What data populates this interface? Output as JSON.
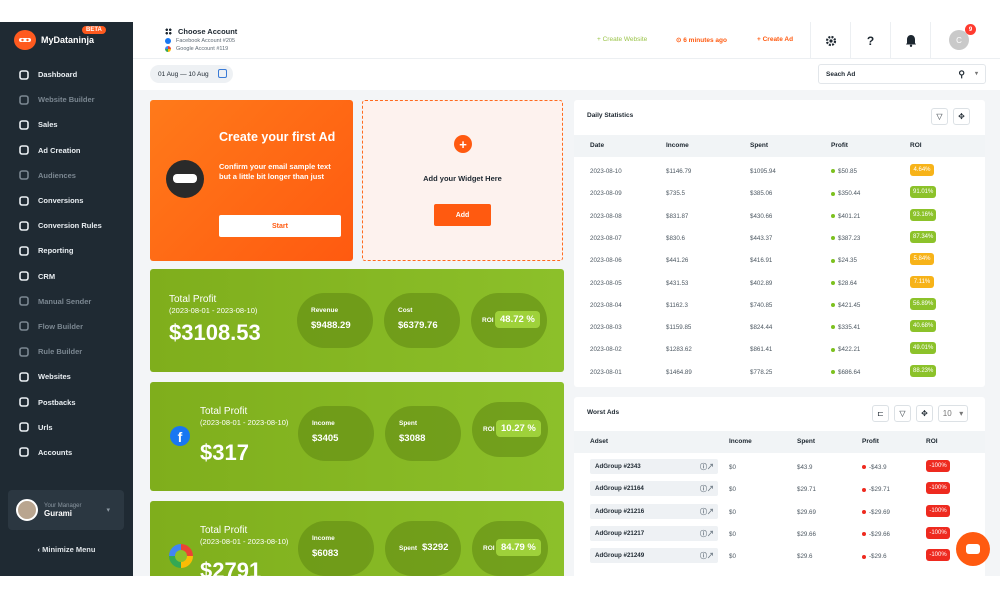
{
  "brand": {
    "name": "MyDataninja",
    "badge": "BETA"
  },
  "nav": [
    {
      "label": "Dashboard",
      "icon": "dashboard-icon",
      "dim": false
    },
    {
      "label": "Website Builder",
      "icon": "website-builder-icon",
      "dim": true
    },
    {
      "label": "Sales",
      "icon": "sales-icon",
      "dim": false
    },
    {
      "label": "Ad Creation",
      "icon": "megaphone-icon",
      "dim": false
    },
    {
      "label": "Audiences",
      "icon": "audiences-icon",
      "dim": true
    },
    {
      "label": "Conversions",
      "icon": "conversions-icon",
      "dim": false
    },
    {
      "label": "Conversion Rules",
      "icon": "conversion-rules-icon",
      "dim": false
    },
    {
      "label": "Reporting",
      "icon": "reporting-icon",
      "dim": false
    },
    {
      "label": "CRM",
      "icon": "crm-icon",
      "dim": false
    },
    {
      "label": "Manual Sender",
      "icon": "send-icon",
      "dim": true
    },
    {
      "label": "Flow Builder",
      "icon": "flow-icon",
      "dim": true
    },
    {
      "label": "Rule Builder",
      "icon": "rule-icon",
      "dim": true
    },
    {
      "label": "Websites",
      "icon": "globe-icon",
      "dim": false
    },
    {
      "label": "Postbacks",
      "icon": "anchor-icon",
      "dim": false
    },
    {
      "label": "Urls",
      "icon": "link-icon",
      "dim": false
    },
    {
      "label": "Accounts",
      "icon": "accounts-icon",
      "dim": false
    }
  ],
  "manager": {
    "label": "Your Manager",
    "name": "Gurami"
  },
  "minimize_label": "‹ Minimize Menu",
  "topbar": {
    "account_title": "Choose Account",
    "account_fb": "Facebook Account #205",
    "account_google": "Google Account #119",
    "create_website": "+ Create Website",
    "time_ago": "6 minutes ago",
    "create_ad": "+ Create Ad",
    "avatar_letter": "C",
    "notif_count": "9"
  },
  "date_range": {
    "from": "01 Aug",
    "to": "— 10 Aug"
  },
  "search": {
    "value": "Seach Ad"
  },
  "create_card": {
    "title": "Create your first Ad",
    "text": "Confirm your email sample text but a little bit longer than just",
    "button": "Start"
  },
  "widget_card": {
    "text": "Add your Widget Here",
    "button": "Add"
  },
  "profit_total": {
    "title": "Total Profit",
    "date": "(2023-08-01 - 2023-08-10)",
    "amount": "$3108.53",
    "revenue_label": "Revenue",
    "revenue": "$9488.29",
    "cost_label": "Cost",
    "cost": "$6379.76",
    "roi_label": "ROI",
    "roi": "48.72 %"
  },
  "profit_facebook": {
    "title": "Total Profit",
    "date": "(2023-08-01 - 2023-08-10)",
    "amount": "$317",
    "income_label": "Income",
    "income": "$3405",
    "spent_label": "Spent",
    "spent": "$3088",
    "roi_label": "ROI",
    "roi": "10.27 %"
  },
  "profit_google": {
    "title": "Total Profit",
    "date": "(2023-08-01 - 2023-08-10)",
    "amount": "$2791",
    "income_label": "Income",
    "income": "$6083",
    "spent_label": "Spent",
    "spent": "$3292",
    "roi_label": "ROI",
    "roi": "84.79 %"
  },
  "daily": {
    "title": "Daily Statistics",
    "headers": [
      "Date",
      "Income",
      "Spent",
      "Profit",
      "ROI"
    ],
    "rows": [
      {
        "date": "2023-08-10",
        "income": "$1146.79",
        "spent": "$1095.94",
        "profit": "$50.85",
        "roi": "4.64%",
        "color": "#f7b319"
      },
      {
        "date": "2023-08-09",
        "income": "$735.5",
        "spent": "$385.06",
        "profit": "$350.44",
        "roi": "91.01%",
        "color": "#8cc22a"
      },
      {
        "date": "2023-08-08",
        "income": "$831.87",
        "spent": "$430.66",
        "profit": "$401.21",
        "roi": "93.16%",
        "color": "#8cc22a"
      },
      {
        "date": "2023-08-07",
        "income": "$830.6",
        "spent": "$443.37",
        "profit": "$387.23",
        "roi": "87.34%",
        "color": "#8cc22a"
      },
      {
        "date": "2023-08-06",
        "income": "$441.26",
        "spent": "$416.91",
        "profit": "$24.35",
        "roi": "5.84%",
        "color": "#f7b319"
      },
      {
        "date": "2023-08-05",
        "income": "$431.53",
        "spent": "$402.89",
        "profit": "$28.64",
        "roi": "7.11%",
        "color": "#f7b319"
      },
      {
        "date": "2023-08-04",
        "income": "$1162.3",
        "spent": "$740.85",
        "profit": "$421.45",
        "roi": "56.89%",
        "color": "#8cc22a"
      },
      {
        "date": "2023-08-03",
        "income": "$1159.85",
        "spent": "$824.44",
        "profit": "$335.41",
        "roi": "40.68%",
        "color": "#8cc22a"
      },
      {
        "date": "2023-08-02",
        "income": "$1283.62",
        "spent": "$861.41",
        "profit": "$422.21",
        "roi": "49.01%",
        "color": "#8cc22a"
      },
      {
        "date": "2023-08-01",
        "income": "$1464.89",
        "spent": "$778.25",
        "profit": "$686.64",
        "roi": "88.23%",
        "color": "#8cc22a"
      }
    ]
  },
  "worst": {
    "title": "Worst Ads",
    "page_size": "10",
    "headers": [
      "Adset",
      "Income",
      "Spent",
      "Profit",
      "ROI"
    ],
    "rows": [
      {
        "adset": "AdGroup #2343",
        "income": "$0",
        "spent": "$43.9",
        "profit": "-$43.9",
        "roi": "-100%"
      },
      {
        "adset": "AdGroup #21164",
        "income": "$0",
        "spent": "$29.71",
        "profit": "-$29.71",
        "roi": "-100%"
      },
      {
        "adset": "AdGroup #21216",
        "income": "$0",
        "spent": "$29.69",
        "profit": "-$29.69",
        "roi": "-100%"
      },
      {
        "adset": "AdGroup #21217",
        "income": "$0",
        "spent": "$29.66",
        "profit": "-$29.66",
        "roi": "-100%"
      },
      {
        "adset": "AdGroup #21249",
        "income": "$0",
        "spent": "$29.6",
        "profit": "-$29.6",
        "roi": "-100%"
      }
    ]
  },
  "colors": {
    "accent": "#ff5a10",
    "green": "#8cc22a",
    "sidebar": "#1f2a33",
    "negative": "#ee2a1f"
  }
}
